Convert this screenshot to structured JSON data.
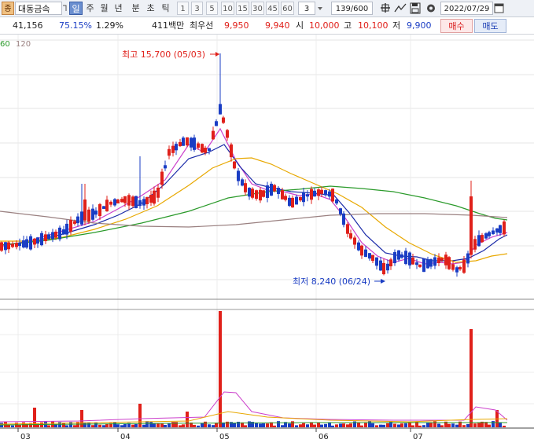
{
  "toolbar": {
    "stock_code_icon": "square-icon",
    "stock_name": "대동금속",
    "periods": [
      "일",
      "주",
      "월",
      "년",
      "분",
      "초",
      "틱"
    ],
    "active_period": "일",
    "minute_buttons": [
      "1",
      "3",
      "5",
      "10",
      "15",
      "30",
      "45",
      "60"
    ],
    "interval_value": "3",
    "count": "139/600",
    "date": "2022/07/29"
  },
  "info": {
    "volume": "41,156",
    "turnover_ratio": "75.15%",
    "change_rate": "1.29%",
    "amount": "411백만",
    "best_bid_label": "최우선",
    "best_ask_price": "9,950",
    "best_bid_price": "9,940",
    "open_label": "시",
    "open_value": "10,000",
    "high_label": "고",
    "high_value": "10,100",
    "low_label": "저",
    "low_value": "9,900",
    "buy_label": "매수",
    "sell_label": "매도"
  },
  "ma_labels": [
    "60",
    "120"
  ],
  "annotations": {
    "high": "최고 15,700 (05/03)",
    "low": "최저 8,240 (06/24)"
  },
  "colors": {
    "up": "#e0201a",
    "down": "#1a3dc4",
    "ma5": "#cc40cc",
    "ma10": "#1a2aa8",
    "ma20": "#e8a800",
    "ma60": "#2a9a2a",
    "ma120": "#9a8080"
  },
  "x_axis_labels": [
    "03",
    "04",
    "05",
    "06",
    "07"
  ]
}
